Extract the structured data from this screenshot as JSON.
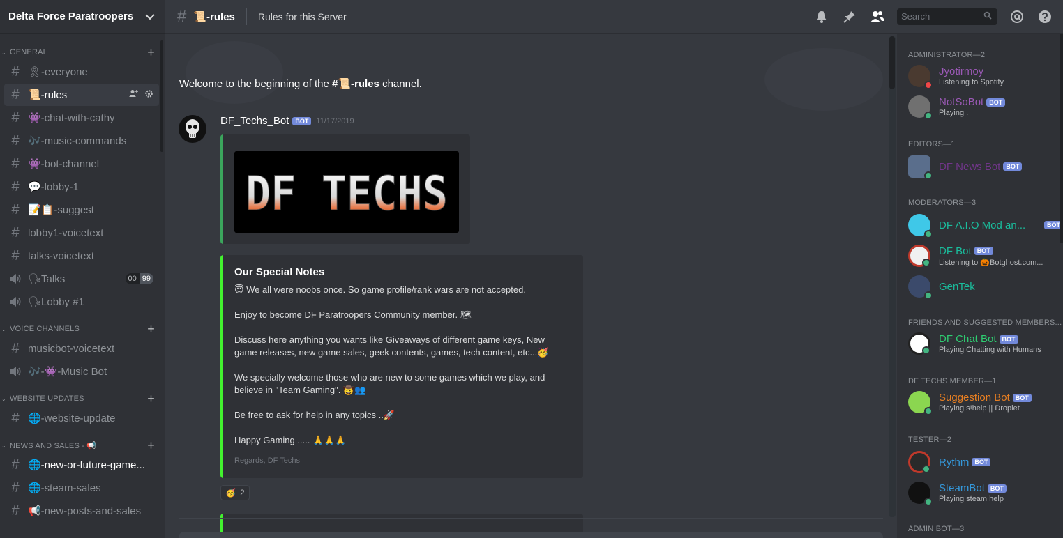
{
  "server": {
    "name": "Delta Force Paratroopers"
  },
  "sidebar": {
    "categories": [
      {
        "label": "GENERAL"
      },
      {
        "label": "VOICE CHANNELS"
      },
      {
        "label": "WEBSITE UPDATES"
      },
      {
        "label": "NEWS AND SALES - 📢"
      }
    ],
    "channels": [
      {
        "label": "🎗-everyone"
      },
      {
        "label": "📜-rules"
      },
      {
        "label": "👾-chat-with-cathy"
      },
      {
        "label": "🎶-music-commands"
      },
      {
        "label": "👾-bot-channel"
      },
      {
        "label": "💬-lobby-1"
      },
      {
        "label": "📝📋-suggest"
      },
      {
        "label": "lobby1-voicetext"
      },
      {
        "label": "talks-voicetext"
      },
      {
        "label": "🗣Talks",
        "count_a": "00",
        "count_b": "99"
      },
      {
        "label": "🗣Lobby #1"
      },
      {
        "label": "musicbot-voicetext"
      },
      {
        "label": "🎶-👾-Music Bot"
      },
      {
        "label": "🌐-website-update"
      },
      {
        "label": "🌐-new-or-future-game..."
      },
      {
        "label": "🌐-steam-sales"
      },
      {
        "label": "📢-new-posts-and-sales"
      }
    ]
  },
  "topbar": {
    "channel_name": "📜-rules",
    "topic": "Rules for this Server",
    "search_placeholder": "Search"
  },
  "chat": {
    "welcome_prefix": "Welcome to the beginning of the ",
    "welcome_channel": "#📜-rules",
    "welcome_suffix": " channel.",
    "message": {
      "author": "DF_Techs_Bot",
      "bot_tag": "BOT",
      "timestamp": "11/17/2019",
      "banner_text": "DF TECHS",
      "embed_title": "Our Special Notes",
      "paragraphs": [
        "😇 We all were noobs once. So game profile/rank wars are not accepted.",
        "Enjoy to become DF Paratroopers Community member. 🗺",
        "Discuss here anything you wants like Giveaways of different game keys, New game releases, new game sales, geek contents, games, tech content, etc...🥳",
        "We specially welcome those who are new to some games which we play, and believe in \"Team Gaming\". 🤠👥",
        "Be free to ask for help in any topics ..🚀",
        "Happy Gaming ..... 🙏🙏🙏"
      ],
      "footer": "Regards, DF Techs",
      "reaction_emoji": "🥳",
      "reaction_count": "2"
    }
  },
  "members": {
    "groups": [
      {
        "label": "ADMINISTRATOR—2"
      },
      {
        "label": "EDITORS—1"
      },
      {
        "label": "MODERATORS—3"
      },
      {
        "label": "FRIENDS AND SUGGESTED MEMBERS..."
      },
      {
        "label": "DF TECHS MEMBER—1"
      },
      {
        "label": "TESTER—2"
      },
      {
        "label": "ADMIN BOT—3"
      }
    ],
    "list": [
      {
        "name": "Jyotirmoy",
        "activity": "Listening to Spotify",
        "color": "#9b59b6",
        "bot": ""
      },
      {
        "name": "NotSoBot",
        "activity": "Playing .",
        "color": "#9b59b6",
        "bot": "BOT"
      },
      {
        "name": "DF News Bot",
        "activity": "",
        "color": "#71368a",
        "bot": "BOT"
      },
      {
        "name": "DF A.I.O Mod an...",
        "activity": "",
        "color": "#1abc9c",
        "bot": "BOT"
      },
      {
        "name": "DF Bot",
        "activity": "Listening to 🎃Botghost.com...",
        "color": "#1abc9c",
        "bot": "BOT"
      },
      {
        "name": "GenTek",
        "activity": "",
        "color": "#1abc9c",
        "bot": ""
      },
      {
        "name": "DF Chat Bot",
        "activity": "Playing Chatting with Humans",
        "color": "#2ecc71",
        "bot": "BOT"
      },
      {
        "name": "Suggestion Bot",
        "activity": "Playing s!help || Droplet",
        "color": "#e67e22",
        "bot": "BOT"
      },
      {
        "name": "Rythm",
        "activity": "",
        "color": "#3498db",
        "bot": "BOT"
      },
      {
        "name": "SteamBot",
        "activity": "Playing steam help",
        "color": "#3498db",
        "bot": "BOT"
      }
    ]
  },
  "colors": {
    "accent": "#7289da",
    "online": "#43b581",
    "dnd": "#f04747"
  }
}
